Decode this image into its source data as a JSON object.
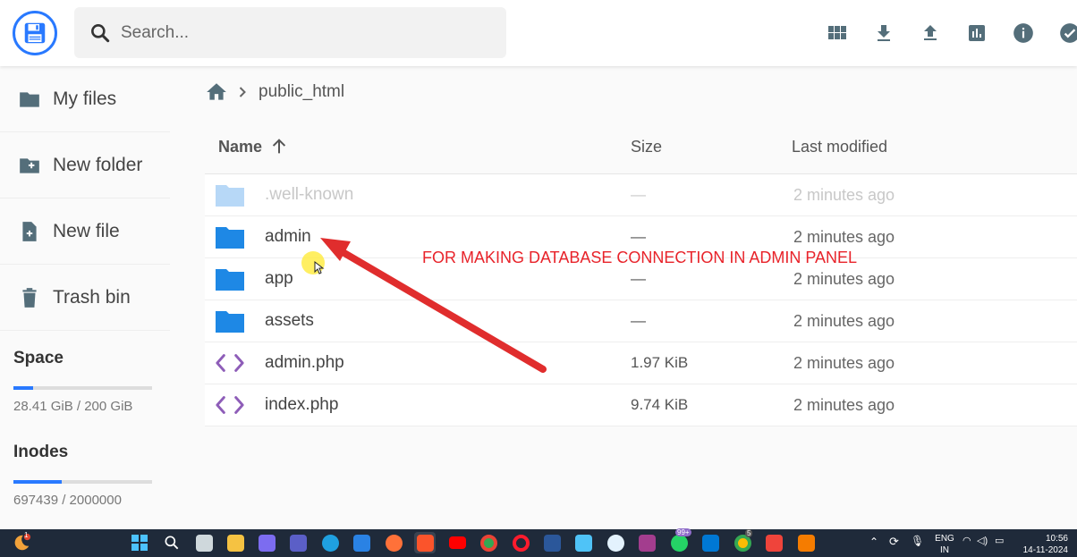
{
  "header": {
    "search_placeholder": "Search...",
    "actions": [
      "grid-view-icon",
      "download-icon",
      "upload-icon",
      "chart-icon",
      "info-icon",
      "check-circle-icon"
    ]
  },
  "sidebar": {
    "items": [
      {
        "label": "My files",
        "icon": "folder-icon"
      },
      {
        "label": "New folder",
        "icon": "new-folder-icon"
      },
      {
        "label": "New file",
        "icon": "new-file-icon"
      },
      {
        "label": "Trash bin",
        "icon": "trash-icon"
      }
    ],
    "space": {
      "title": "Space",
      "value": "28.41 GiB / 200 GiB",
      "fill": 0.142
    },
    "inodes": {
      "title": "Inodes",
      "value": "697439 / 2000000",
      "fill": 0.349
    }
  },
  "breadcrumb": {
    "current": "public_html"
  },
  "listing": {
    "headers": {
      "name": "Name",
      "size": "Size",
      "modified": "Last modified"
    },
    "rows": [
      {
        "name": ".well-known",
        "size": "—",
        "modified": "2 minutes ago",
        "type": "folder",
        "dim": true
      },
      {
        "name": "admin",
        "size": "—",
        "modified": "2 minutes ago",
        "type": "folder",
        "dim": false
      },
      {
        "name": "app",
        "size": "—",
        "modified": "2 minutes ago",
        "type": "folder",
        "dim": false
      },
      {
        "name": "assets",
        "size": "—",
        "modified": "2 minutes ago",
        "type": "folder",
        "dim": false
      },
      {
        "name": "admin.php",
        "size": "1.97 KiB",
        "modified": "2 minutes ago",
        "type": "code",
        "dim": false
      },
      {
        "name": "index.php",
        "size": "9.74 KiB",
        "modified": "2 minutes ago",
        "type": "code",
        "dim": false
      }
    ]
  },
  "annotation": {
    "text": "FOR MAKING DATABASE CONNECTION IN ADMIN PANEL",
    "color": "#e8232a"
  },
  "colors": {
    "accent": "#2979ff",
    "folder": "#1e88e5",
    "code": "#8e5db8"
  },
  "taskbar": {
    "notification_count": "1",
    "whatsapp_badge": "99+",
    "chrome_badge": "5",
    "language_top": "ENG",
    "language_bottom": "IN",
    "time": "10:56",
    "date": "14-11-2024"
  }
}
